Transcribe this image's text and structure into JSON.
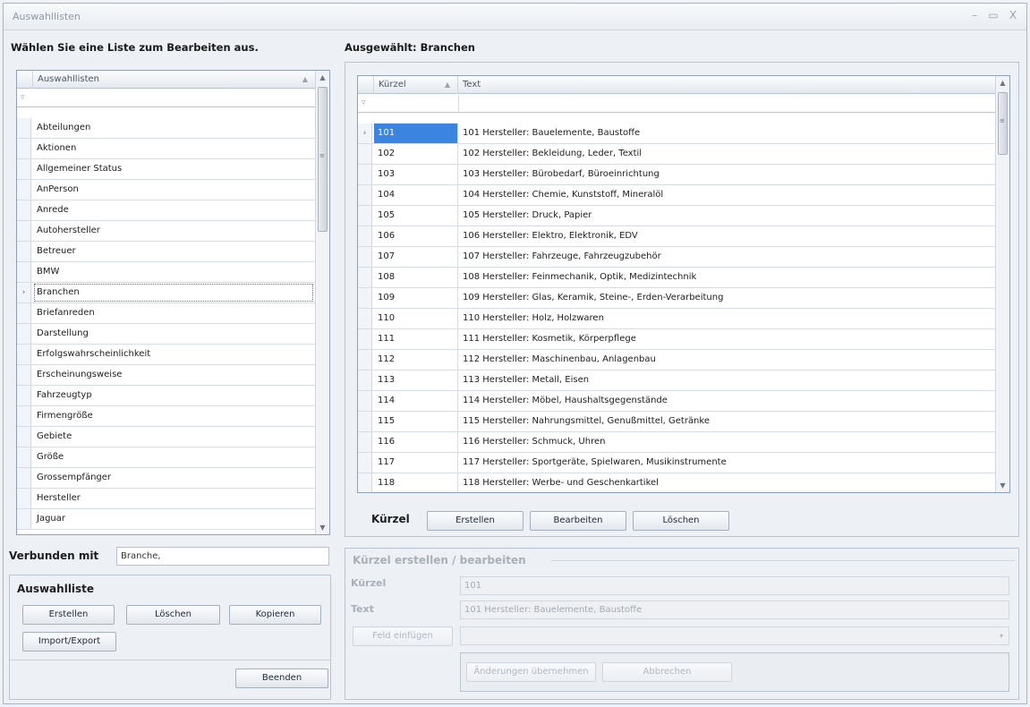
{
  "window": {
    "title": "Auswahllisten",
    "minimize": "–",
    "maximize": "▭",
    "close": "X"
  },
  "left": {
    "heading": "Wählen Sie eine Liste zum Bearbeiten aus.",
    "column_header": "Auswahllisten",
    "items": [
      "Abteilungen",
      "Aktionen",
      "Allgemeiner Status",
      "AnPerson",
      "Anrede",
      "Autohersteller",
      "Betreuer",
      "BMW",
      "Branchen",
      "Briefanreden",
      "Darstellung",
      "Erfolgswahrscheinlichkeit",
      "Erscheinungsweise",
      "Fahrzeugtyp",
      "Firmengröße",
      "Gebiete",
      "Größe",
      "Grossempfänger",
      "Hersteller",
      "Jaguar"
    ],
    "selected_index": 8,
    "connected_label": "Verbunden mit",
    "connected_value": "Branche,",
    "group_title": "Auswahlliste",
    "buttons": {
      "create": "Erstellen",
      "delete": "Löschen",
      "copy": "Kopieren",
      "import_export": "Import/Export",
      "close": "Beenden"
    }
  },
  "right": {
    "heading": "Ausgewählt: Branchen",
    "columns": {
      "code": "Kürzel",
      "text": "Text"
    },
    "rows": [
      {
        "code": "101",
        "text": "101 Hersteller: Bauelemente, Baustoffe"
      },
      {
        "code": "102",
        "text": "102 Hersteller: Bekleidung, Leder, Textil"
      },
      {
        "code": "103",
        "text": "103 Hersteller: Bürobedarf, Büroeinrichtung"
      },
      {
        "code": "104",
        "text": "104 Hersteller: Chemie, Kunststoff, Mineralöl"
      },
      {
        "code": "105",
        "text": "105 Hersteller: Druck, Papier"
      },
      {
        "code": "106",
        "text": "106 Hersteller: Elektro, Elektronik, EDV"
      },
      {
        "code": "107",
        "text": "107 Hersteller: Fahrzeuge, Fahrzeugzubehör"
      },
      {
        "code": "108",
        "text": "108 Hersteller: Feinmechanik, Optik, Medizintechnik"
      },
      {
        "code": "109",
        "text": "109 Hersteller: Glas, Keramik, Steine-, Erden-Verarbeitung"
      },
      {
        "code": "110",
        "text": "110 Hersteller: Holz, Holzwaren"
      },
      {
        "code": "111",
        "text": "111 Hersteller: Kosmetik, Körperpflege"
      },
      {
        "code": "112",
        "text": "112 Hersteller: Maschinenbau, Anlagenbau"
      },
      {
        "code": "113",
        "text": "113 Hersteller: Metall, Eisen"
      },
      {
        "code": "114",
        "text": "114 Hersteller: Möbel, Haushaltsgegenstände"
      },
      {
        "code": "115",
        "text": "115 Hersteller: Nahrungsmittel, Genußmittel, Getränke"
      },
      {
        "code": "116",
        "text": "116 Hersteller: Schmuck, Uhren"
      },
      {
        "code": "117",
        "text": "117 Hersteller: Sportgeräte, Spielwaren, Musikinstrumente"
      },
      {
        "code": "118",
        "text": "118 Hersteller: Werbe- und Geschenkartikel"
      }
    ],
    "selected_index": 0,
    "bar_label": "Kürzel",
    "buttons": {
      "create": "Erstellen",
      "edit": "Bearbeiten",
      "delete": "Löschen"
    },
    "edit": {
      "group_title": "Kürzel erstellen / bearbeiten",
      "code_label": "Kürzel",
      "code_value": "101",
      "text_label": "Text",
      "text_value": "101 Hersteller: Bauelemente, Baustoffe",
      "insert_field": "Feld einfügen",
      "apply": "Änderungen übernehmen",
      "cancel": "Abbrechen"
    }
  }
}
